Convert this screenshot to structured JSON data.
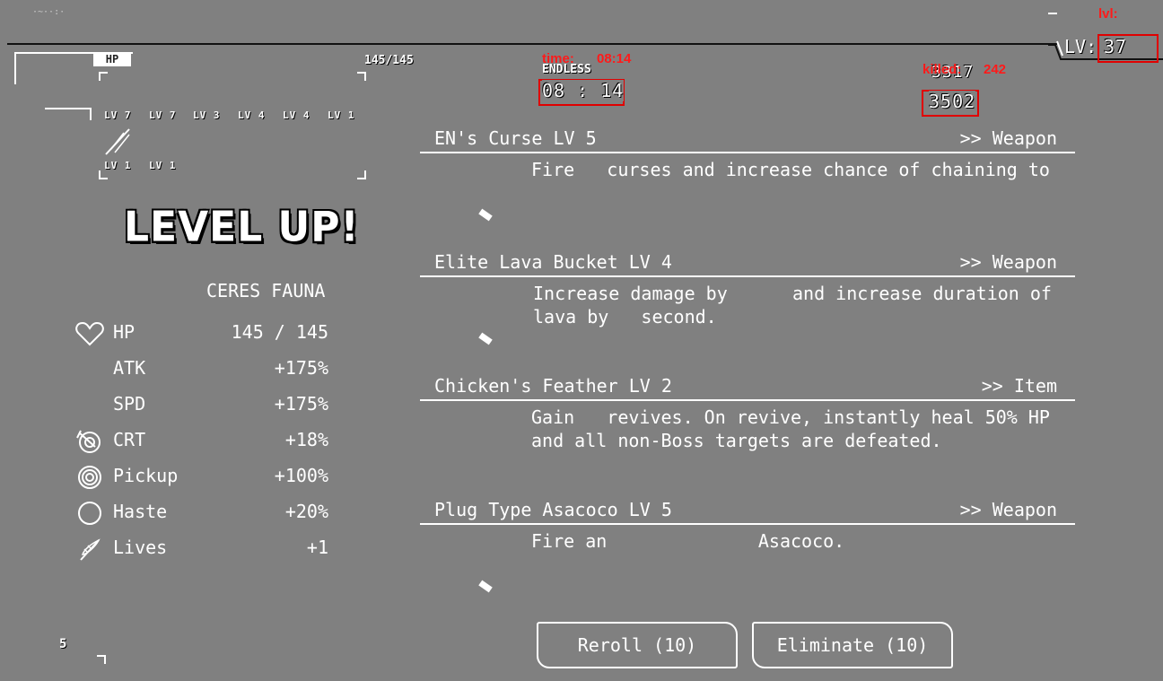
{
  "hud": {
    "hp_label": "HP",
    "hp_value": "145/145",
    "mode_label": "ENDLESS",
    "timer": "08 : 14",
    "debug_time_label": "time:",
    "debug_time_value": "08:14",
    "debug_killed_label": "killed:",
    "debug_killed_value": "242",
    "kills_overlapped": "3317",
    "score": "3502",
    "debug_lvl_label": "lvl:",
    "level_prefix": "LV:",
    "level_value": "37",
    "bottom_counter": "5",
    "slot_levels_row1": [
      "LV 7",
      "LV 7",
      "LV 3",
      "LV 4",
      "LV 4",
      "LV 1"
    ],
    "slot_levels_row2": [
      "LV 1",
      "LV 1"
    ],
    "top_left_label": "ꟷꟷꟷ"
  },
  "level_up": {
    "title": "LEVEL UP!",
    "character": "CERES FAUNA"
  },
  "stats": [
    {
      "icon": "heart-icon",
      "name": "HP",
      "value": "145 / 145"
    },
    {
      "icon": "",
      "name": "ATK",
      "value": "+175%"
    },
    {
      "icon": "",
      "name": "SPD",
      "value": "+175%"
    },
    {
      "icon": "target-icon",
      "name": "CRT",
      "value": "+18%"
    },
    {
      "icon": "magnet-ring-icon",
      "name": "Pickup",
      "value": "+100%"
    },
    {
      "icon": "circle-icon",
      "name": "Haste",
      "value": "+20%"
    },
    {
      "icon": "feather-icon",
      "name": "Lives",
      "value": "+1"
    }
  ],
  "cards": [
    {
      "title": "EN's Curse LV 5",
      "type": ">> Weapon",
      "desc": "Fire   curses and increase chance of chaining to"
    },
    {
      "title": "Elite Lava Bucket LV 4",
      "type": ">> Weapon",
      "desc": "Increase damage by      and increase duration of\nlava by   second."
    },
    {
      "title": "Chicken's Feather LV 2",
      "type": ">> Item",
      "desc": "Gain   revives. On revive, instantly heal 50% HP\nand all non-Boss targets are defeated."
    },
    {
      "title": "Plug Type Asacoco LV 5",
      "type": ">> Weapon",
      "desc": "Fire an              Asacoco."
    }
  ],
  "buttons": {
    "reroll": "Reroll (10)",
    "eliminate": "Eliminate (10)"
  }
}
